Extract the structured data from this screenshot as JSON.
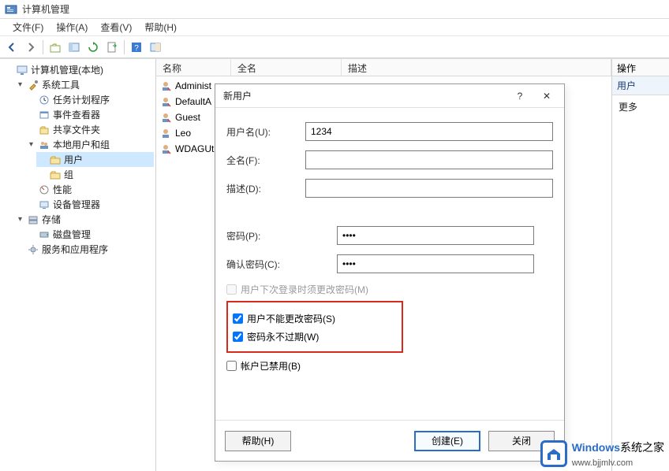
{
  "titlebar": {
    "title": "计算机管理"
  },
  "menubar": {
    "file": "文件(F)",
    "action": "操作(A)",
    "view": "查看(V)",
    "help": "帮助(H)"
  },
  "tree": {
    "root": "计算机管理(本地)",
    "system_tools": "系统工具",
    "task_scheduler": "任务计划程序",
    "event_viewer": "事件查看器",
    "shared_folders": "共享文件夹",
    "local_users_groups": "本地用户和组",
    "users": "用户",
    "groups": "组",
    "performance": "性能",
    "device_manager": "设备管理器",
    "storage": "存储",
    "disk_management": "磁盘管理",
    "services_apps": "服务和应用程序"
  },
  "list": {
    "cols": {
      "name": "名称",
      "fullname": "全名",
      "desc": "描述"
    },
    "rows": [
      {
        "name": "Administ"
      },
      {
        "name": "DefaultA"
      },
      {
        "name": "Guest"
      },
      {
        "name": "Leo"
      },
      {
        "name": "WDAGUt"
      }
    ]
  },
  "actions": {
    "header": "操作",
    "group_title": "用户",
    "more": "更多"
  },
  "dialog": {
    "title": "新用户",
    "help_glyph": "?",
    "close_glyph": "✕",
    "labels": {
      "username": "用户名(U):",
      "fullname": "全名(F):",
      "description": "描述(D):",
      "password": "密码(P):",
      "confirm": "确认密码(C):"
    },
    "values": {
      "username": "1234",
      "fullname": "",
      "description": "",
      "password": "••••",
      "confirm": "••••"
    },
    "checkboxes": {
      "must_change": "用户下次登录时须更改密码(M)",
      "cannot_change": "用户不能更改密码(S)",
      "never_expires": "密码永不过期(W)",
      "disabled": "帐户已禁用(B)"
    },
    "buttons": {
      "help": "帮助(H)",
      "create": "创建(E)",
      "close": "关闭"
    }
  },
  "watermark": {
    "text_prefix": "Windows",
    "text_suffix": "系统之家",
    "url": "www.bjjmlv.com"
  }
}
